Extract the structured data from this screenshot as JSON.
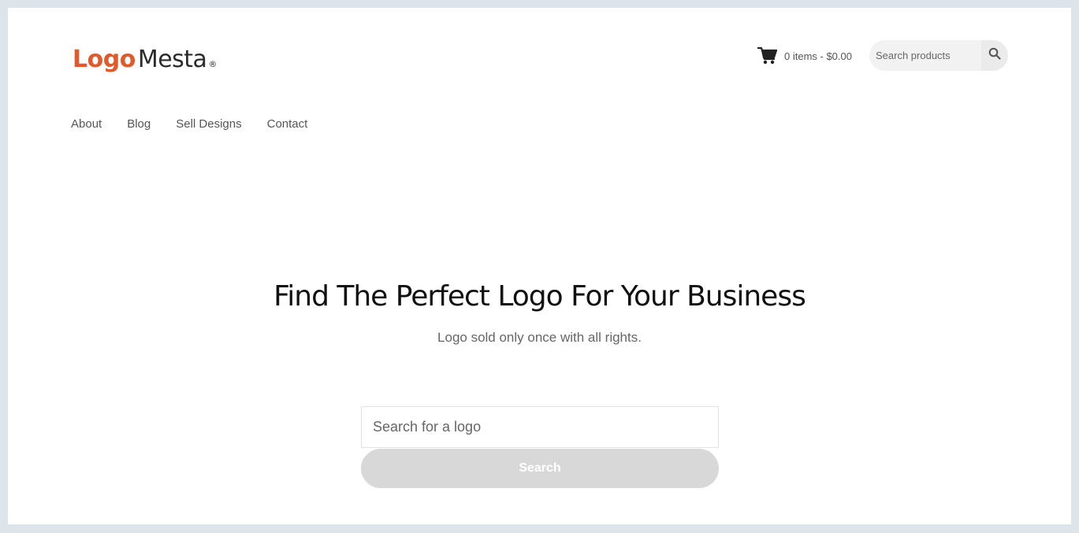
{
  "logo": {
    "part1": "Logo",
    "part2": "Mesta",
    "reg": "®",
    "color_accent": "#e05a2a"
  },
  "cart": {
    "icon": "shopping-cart-icon",
    "text": "0 items - $0.00"
  },
  "top_search": {
    "placeholder": "Search products",
    "icon": "search-icon"
  },
  "nav": {
    "items": [
      {
        "label": "About"
      },
      {
        "label": "Blog"
      },
      {
        "label": "Sell Designs"
      },
      {
        "label": "Contact"
      }
    ]
  },
  "hero": {
    "title": "Find The Perfect Logo For Your Business",
    "subtitle": "Logo sold only once with all rights.",
    "search_placeholder": "Search for a logo",
    "search_button": "Search"
  },
  "colors": {
    "background_frame": "#dde5ea",
    "page": "#ffffff",
    "button_disabled": "#d8d8d8"
  }
}
